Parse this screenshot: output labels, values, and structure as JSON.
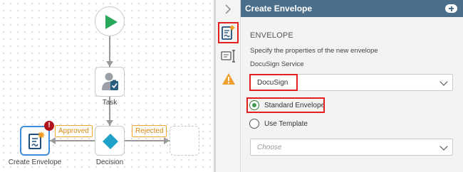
{
  "canvas": {
    "task_label": "Task",
    "decision_label": "Decision",
    "envelope_label": "Create Envelope",
    "approved_label": "Approved",
    "rejected_label": "Rejected",
    "error_badge": "!"
  },
  "strip": {
    "collapse_icon": "chevron-right-icon",
    "items": [
      "envelope-properties-icon",
      "field-mapping-icon",
      "warning-icon"
    ]
  },
  "panel": {
    "title": "Create Envelope",
    "section_title": "ENVELOPE",
    "description": "Specify the properties of the new envelope",
    "service_label": "DocuSign Service",
    "service_value": "DocuSign",
    "radio_options": [
      "Standard Envelope",
      "Use Template"
    ],
    "selected_option": "Standard Envelope",
    "template_placeholder": "Choose"
  },
  "colors": {
    "header_bg": "#4b6e8a",
    "highlight": "#e32020",
    "start_green": "#27a85a",
    "decision_teal": "#1ea2c7",
    "tag_orange": "#f0a936",
    "error_red": "#b0121c"
  }
}
